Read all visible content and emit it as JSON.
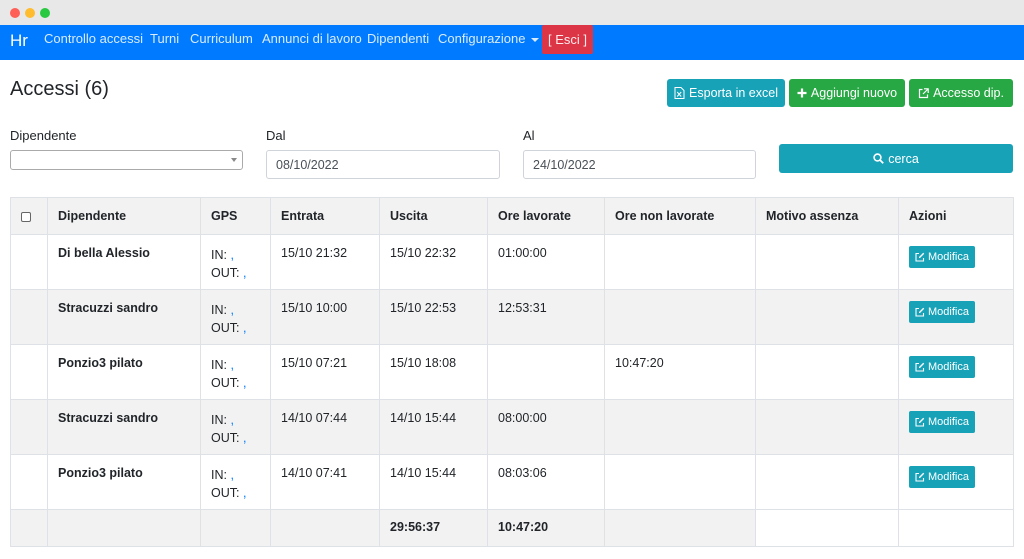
{
  "navbar": {
    "brand": "Hr",
    "items": [
      "Controllo accessi",
      "Turni",
      "Curriculum",
      "Annunci di lavoro",
      "Dipendenti",
      "Configurazione"
    ],
    "logout": "[ Esci ]"
  },
  "page": {
    "title": "Accessi (6)"
  },
  "toolbar": {
    "export_label": "Esporta in excel",
    "add_label": "Aggiungi nuovo",
    "access_label": "Accesso dip."
  },
  "filters": {
    "employee_label": "Dipendente",
    "employee_value": "",
    "from_label": "Dal",
    "from_value": "08/10/2022",
    "to_label": "Al",
    "to_value": "24/10/2022",
    "search_label": "cerca"
  },
  "table": {
    "headers": [
      "Dipendente",
      "GPS",
      "Entrata",
      "Uscita",
      "Ore lavorate",
      "Ore non lavorate",
      "Motivo assenza",
      "Azioni"
    ],
    "gps_in": "IN:",
    "gps_out": "OUT:",
    "gps_link": ",",
    "edit_label": "Modifica",
    "rows": [
      {
        "name": "Di bella Alessio",
        "entry": "15/10 21:32",
        "exit": "15/10 22:32",
        "worked": "01:00:00",
        "not_worked": "",
        "reason": ""
      },
      {
        "name": "Stracuzzi sandro",
        "entry": "15/10 10:00",
        "exit": "15/10 22:53",
        "worked": "12:53:31",
        "not_worked": "",
        "reason": ""
      },
      {
        "name": "Ponzio3 pilato",
        "entry": "15/10 07:21",
        "exit": "15/10 18:08",
        "worked": "",
        "not_worked": "10:47:20",
        "reason": ""
      },
      {
        "name": "Stracuzzi sandro",
        "entry": "14/10 07:44",
        "exit": "14/10 15:44",
        "worked": "08:00:00",
        "not_worked": "",
        "reason": ""
      },
      {
        "name": "Ponzio3 pilato",
        "entry": "14/10 07:41",
        "exit": "14/10 15:44",
        "worked": "08:03:06",
        "not_worked": "",
        "reason": ""
      }
    ],
    "totals": {
      "exit": "29:56:37",
      "worked": "10:47:20"
    }
  }
}
